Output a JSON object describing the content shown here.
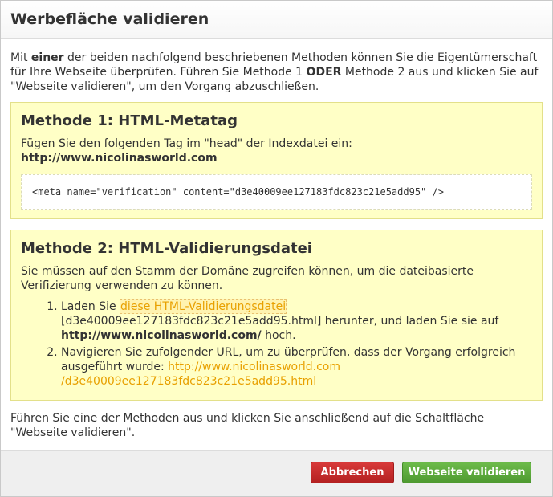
{
  "dialog": {
    "title": "Werbefläche validieren"
  },
  "intro": {
    "part1": "Mit ",
    "bold1": "einer",
    "part2": " der beiden nachfolgend beschriebenen Methoden können Sie die Eigentümerschaft für Ihre Webseite überprüfen. Führen Sie Methode 1 ",
    "bold2": "ODER",
    "part3": " Methode 2 aus und klicken Sie auf \"Webseite validieren\", um den Vorgang abzuschließen."
  },
  "method1": {
    "title": "Methode 1: HTML-Metatag",
    "instruction": "Fügen Sie den folgenden Tag im \"head\" der Indexdatei ein:",
    "domain": "http://www.nicolinasworld.com",
    "code": "<meta name=\"verification\" content=\"d3e40009ee127183fdc823c21e5add95\" />"
  },
  "method2": {
    "title": "Methode 2: HTML-Validierungsdatei",
    "instruction": "Sie müssen auf den Stamm der Domäne zugreifen können, um die dateibasierte Verifizierung verwenden zu können.",
    "step1": {
      "prefix": "Laden Sie ",
      "link": "diese HTML-Validierungsdatei",
      "middle": " [d3e40009ee127183fdc823c21e5add95.html] herunter, und laden Sie sie auf ",
      "domain": "http://www.nicolinasworld.com/",
      "suffix": " hoch."
    },
    "step2": {
      "prefix": "Navigieren Sie zufolgender URL, um zu überprüfen, dass der Vorgang erfolgreich ausgeführt wurde: ",
      "link": "http://www.nicolinasworld.com /d3e40009ee127183fdc823c21e5add95.html"
    }
  },
  "footer_text": "Führen Sie eine der Methoden aus und klicken Sie anschließend auf die Schaltfläche \"Webseite validieren\".",
  "buttons": {
    "cancel": "Abbrechen",
    "validate": "Webseite validieren"
  },
  "colors": {
    "box_bg": "#ffffc6",
    "link": "#e8a000",
    "cancel": "#c62828",
    "validate": "#5aa83a"
  }
}
